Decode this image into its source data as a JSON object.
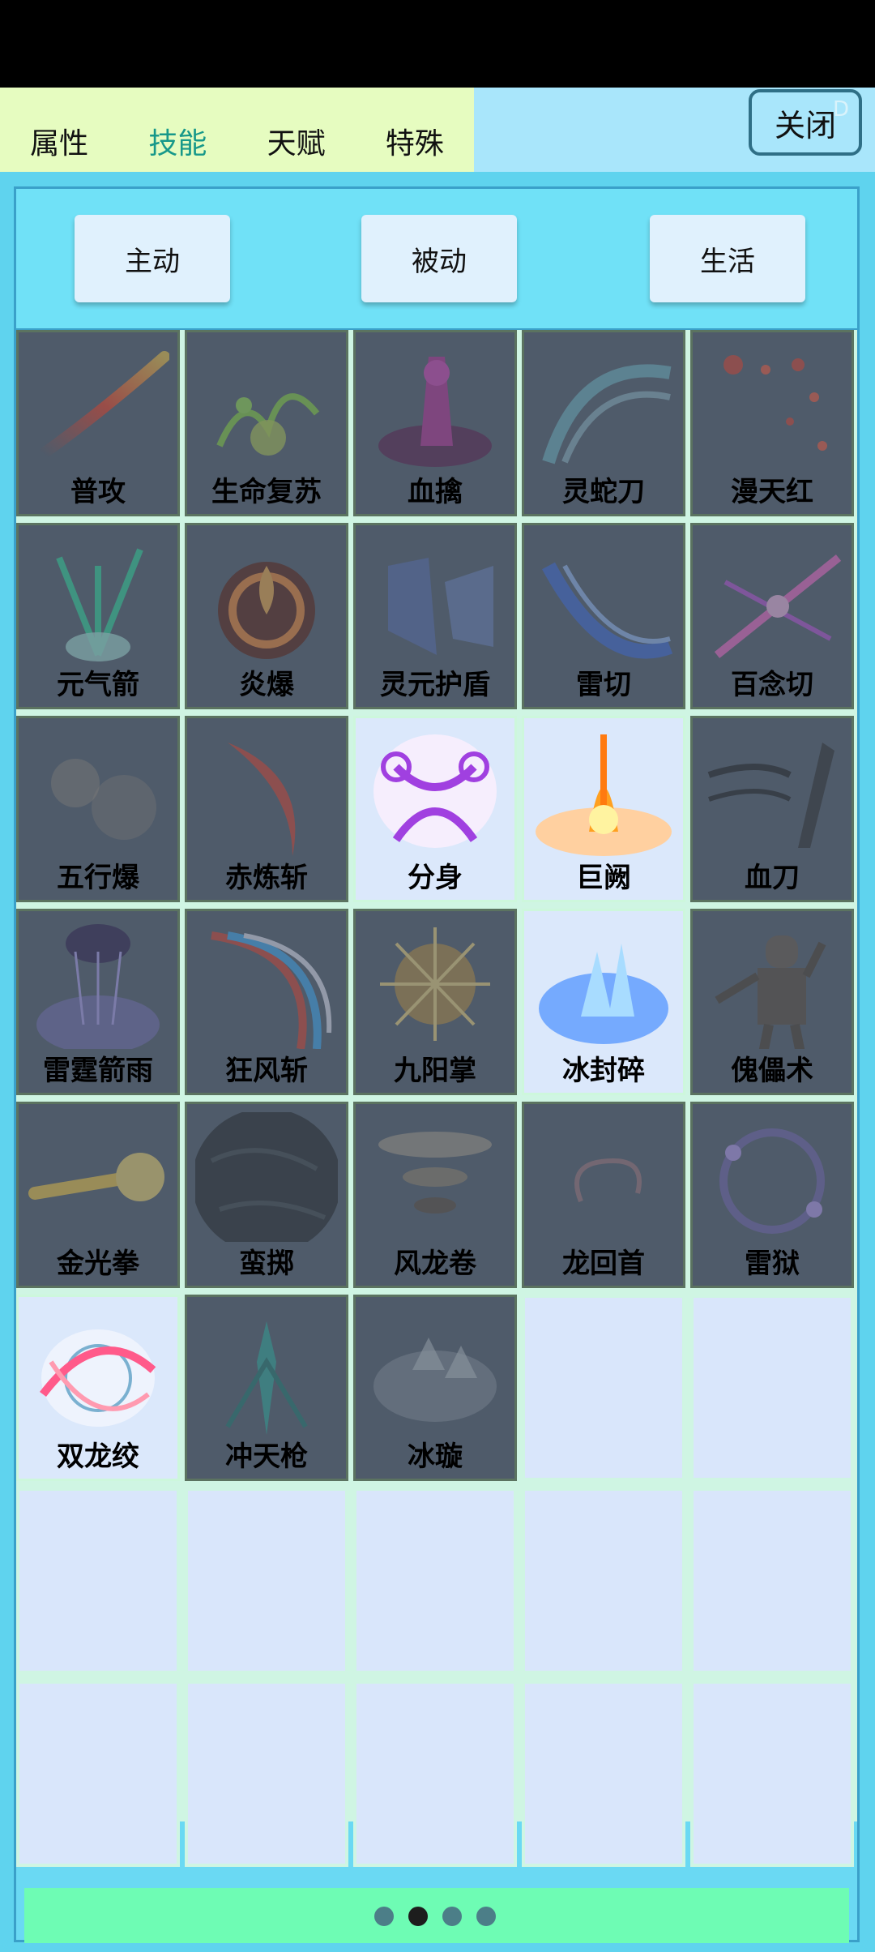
{
  "tabs": [
    {
      "label": "属性",
      "active": false
    },
    {
      "label": "技能",
      "active": true
    },
    {
      "label": "天赋",
      "active": false
    },
    {
      "label": "特殊",
      "active": false
    }
  ],
  "close_label": "关闭",
  "close_ghost": "D",
  "filters": [
    "主动",
    "被动",
    "生活"
  ],
  "skills": [
    {
      "name": "普攻",
      "icon": "red-slash-icon",
      "unlocked": false
    },
    {
      "name": "生命复苏",
      "icon": "green-vine-icon",
      "unlocked": false
    },
    {
      "name": "血擒",
      "icon": "purple-blood-pillar-icon",
      "unlocked": false
    },
    {
      "name": "灵蛇刀",
      "icon": "cyan-wave-icon",
      "unlocked": false
    },
    {
      "name": "漫天红",
      "icon": "red-particles-icon",
      "unlocked": false
    },
    {
      "name": "元气箭",
      "icon": "green-arrow-burst-icon",
      "unlocked": false
    },
    {
      "name": "炎爆",
      "icon": "fire-ring-icon",
      "unlocked": false
    },
    {
      "name": "灵元护盾",
      "icon": "blue-shield-icon",
      "unlocked": false
    },
    {
      "name": "雷切",
      "icon": "blue-lightning-slash-icon",
      "unlocked": false
    },
    {
      "name": "百念切",
      "icon": "pink-cross-slash-icon",
      "unlocked": false
    },
    {
      "name": "五行爆",
      "icon": "faint-dust-icon",
      "unlocked": false
    },
    {
      "name": "赤炼斩",
      "icon": "red-crescent-icon",
      "unlocked": false
    },
    {
      "name": "分身",
      "icon": "purple-clone-icon",
      "unlocked": true
    },
    {
      "name": "巨阙",
      "icon": "flame-sword-icon",
      "unlocked": true
    },
    {
      "name": "血刀",
      "icon": "dark-blade-icon",
      "unlocked": false
    },
    {
      "name": "雷霆箭雨",
      "icon": "purple-storm-icon",
      "unlocked": false
    },
    {
      "name": "狂风斩",
      "icon": "wind-slash-icon",
      "unlocked": false
    },
    {
      "name": "九阳掌",
      "icon": "golden-burst-icon",
      "unlocked": false
    },
    {
      "name": "冰封碎",
      "icon": "ice-crystal-icon",
      "unlocked": true
    },
    {
      "name": "傀儡术",
      "icon": "puppet-icon",
      "unlocked": false
    },
    {
      "name": "金光拳",
      "icon": "golden-fist-icon",
      "unlocked": false
    },
    {
      "name": "蛮掷",
      "icon": "dark-boulder-icon",
      "unlocked": false
    },
    {
      "name": "风龙卷",
      "icon": "tornado-icon",
      "unlocked": false
    },
    {
      "name": "龙回首",
      "icon": "faint-swirl-icon",
      "unlocked": false
    },
    {
      "name": "雷狱",
      "icon": "purple-ring-icon",
      "unlocked": false
    },
    {
      "name": "双龙绞",
      "icon": "twin-dragon-icon",
      "unlocked": true
    },
    {
      "name": "冲天枪",
      "icon": "spear-rise-icon",
      "unlocked": false
    },
    {
      "name": "冰璇",
      "icon": "ice-shard-icon",
      "unlocked": false
    }
  ],
  "empty_slots": 12,
  "page_dots": {
    "count": 4,
    "active": 1
  }
}
